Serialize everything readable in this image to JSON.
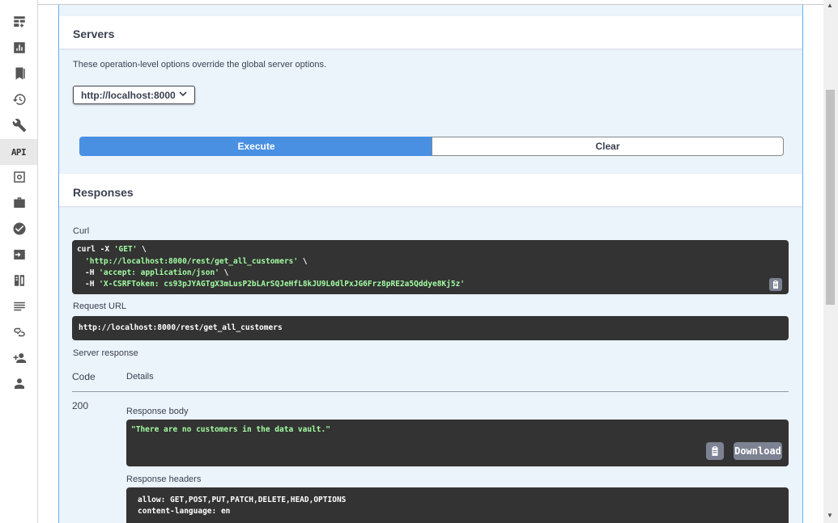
{
  "sidebar": {
    "items": [
      {
        "icon": "table-add-icon"
      },
      {
        "icon": "bar-chart-icon"
      },
      {
        "icon": "bookmarks-icon"
      },
      {
        "icon": "history-icon"
      },
      {
        "icon": "wrench-icon"
      },
      {
        "icon": "api-icon",
        "label": "API",
        "active": true
      },
      {
        "icon": "safe-icon"
      },
      {
        "icon": "briefcase-icon"
      },
      {
        "icon": "check-circle-icon"
      },
      {
        "icon": "import-icon"
      },
      {
        "icon": "document-transfer-icon"
      },
      {
        "icon": "text-lines-icon"
      },
      {
        "icon": "link-icon"
      },
      {
        "icon": "add-user-icon"
      },
      {
        "icon": "user-icon"
      }
    ]
  },
  "servers": {
    "title": "Servers",
    "note": "These operation-level options override the global server options.",
    "selected": "http://localhost:8000"
  },
  "actions": {
    "execute": "Execute",
    "clear": "Clear"
  },
  "responses": {
    "title": "Responses",
    "curl_label": "Curl",
    "curl": {
      "l1_pre": "curl -X ",
      "l1_str": "'GET'",
      "l1_post": " \\",
      "l2_str": "'http://localhost:8000/rest/get_all_customers'",
      "l2_post": " \\",
      "l3_pre": "-H ",
      "l3_str": "'accept: application/json'",
      "l3_post": " \\",
      "l4_pre": "-H ",
      "l4_str": "'X-CSRFToken: cs93pJYAGTgX3mLusP2bLArSQJeHfL8kJU9L0dlPxJG6Frz8pRE2a5Qddye8Kj5z'"
    },
    "request_url_label": "Request URL",
    "request_url": "http://localhost:8000/rest/get_all_customers",
    "server_response_label": "Server response",
    "table": {
      "code_header": "Code",
      "details_header": "Details",
      "code": "200",
      "response_body_label": "Response body",
      "response_body": "\"There are no customers in the data vault.\"",
      "download": "Download",
      "response_headers_label": "Response headers",
      "headers": [
        "allow: GET,POST,PUT,PATCH,DELETE,HEAD,OPTIONS",
        "content-language: en"
      ]
    }
  },
  "colors": {
    "execute": "#4990e2",
    "code_bg": "#333333",
    "string": "#a2fca2",
    "opblock_bg": "#ebf3fb",
    "opblock_border": "#61affe"
  }
}
